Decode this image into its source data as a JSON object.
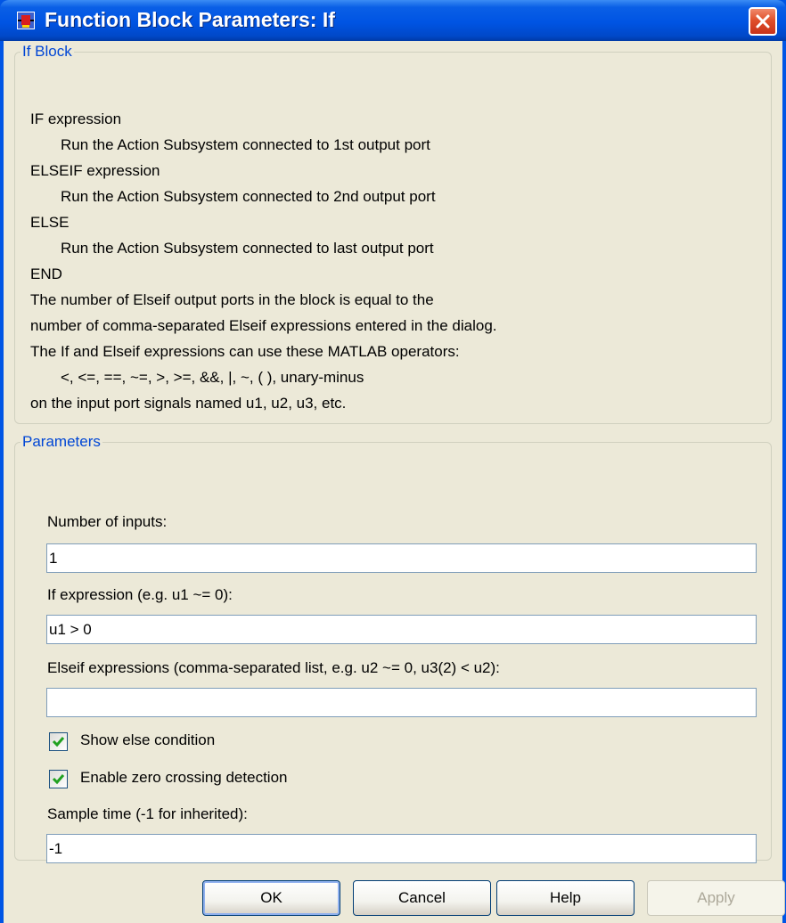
{
  "window": {
    "title": "Function Block Parameters: If"
  },
  "info_group": {
    "title": "If Block",
    "lines": [
      "IF expression",
      "Run the Action Subsystem connected to 1st output port",
      "ELSEIF expression",
      "Run the Action Subsystem connected to 2nd output port",
      "ELSE",
      "Run the Action Subsystem connected to last output port",
      "END",
      "The number of Elseif output ports in the block is equal to the",
      "number of comma-separated Elseif expressions entered in the dialog.",
      "The If and Elseif expressions can use these MATLAB operators:",
      "<, <=, ==, ~=, >, >=, &&, |, ~, ( ), unary-minus",
      "on the input port signals named u1, u2, u3, etc."
    ]
  },
  "params_group": {
    "title": "Parameters",
    "num_inputs": {
      "label": "Number of inputs:",
      "value": "1"
    },
    "if_expr": {
      "label": "If expression (e.g. u1 ~= 0):",
      "value": "u1 > 0"
    },
    "elseif_expr": {
      "label": "Elseif expressions (comma-separated list, e.g. u2 ~= 0, u3(2) < u2):",
      "value": ""
    },
    "show_else": {
      "label": "Show else condition",
      "checked": true
    },
    "zero_crossing": {
      "label": "Enable zero crossing detection",
      "checked": true
    },
    "sample_time": {
      "label": "Sample time (-1 for inherited):",
      "value": "-1"
    }
  },
  "buttons": {
    "ok": "OK",
    "cancel": "Cancel",
    "help": "Help",
    "apply": "Apply"
  },
  "icons": {
    "app": "simulink-block-icon",
    "close": "close-icon",
    "check": "checkmark-icon"
  },
  "colors": {
    "title_bar": "#0054e3",
    "group_title": "#0046d5",
    "close_button": "#e0502b",
    "checkmark": "#21a121"
  }
}
